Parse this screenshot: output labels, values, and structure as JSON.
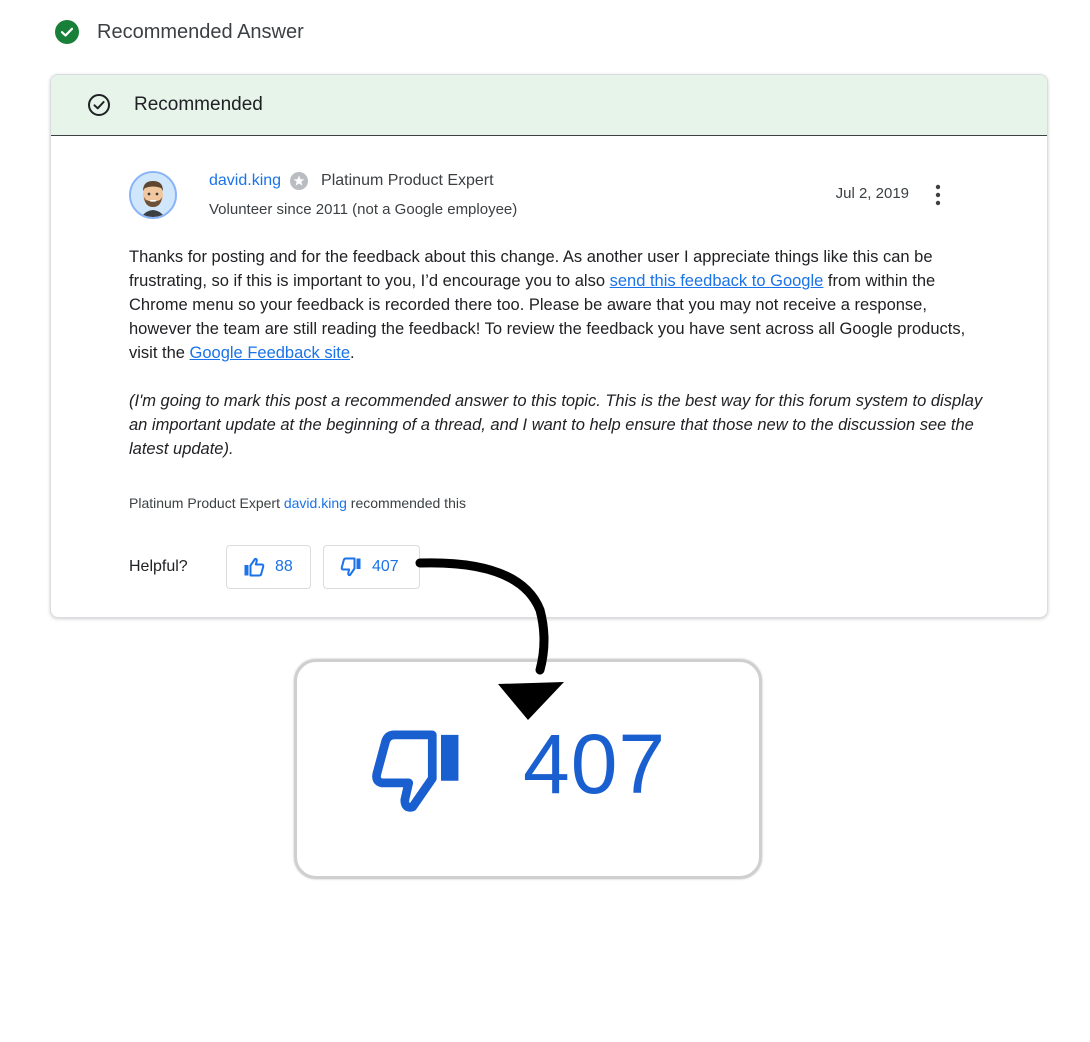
{
  "header": {
    "title": "Recommended Answer"
  },
  "card": {
    "banner_label": "Recommended",
    "author": {
      "name": "david.king",
      "title": "Platinum Product Expert",
      "volunteer": "Volunteer since 2011 (not a Google employee)",
      "date": "Jul 2, 2019"
    },
    "body": {
      "p1_part1": "Thanks for posting and for the feedback about this change. As another user I appreciate things like this can be frustrating, so if this is important to you, I’d encourage you to also ",
      "p1_link1": "send this feedback to Google",
      "p1_part2": " from within the Chrome menu so your feedback is recorded there too. Please be aware that you may not receive a response, however the team are still reading the feedback! To review the feedback you have sent across all Google products, visit the ",
      "p1_link2": "Google Feedback site",
      "p1_part3": ".",
      "note": "(I'm going to mark this post a recommended answer to this topic. This is the best way for this forum system to display an important update at the beginning of a thread, and I want to help ensure that those new to the discussion see the latest update)."
    },
    "recommended_by": {
      "prefix": "Platinum Product Expert ",
      "name": "david.king",
      "suffix": " recommended this"
    },
    "helpful": {
      "label": "Helpful?",
      "up_count": "88",
      "down_count": "407"
    }
  },
  "zoom": {
    "count": "407"
  },
  "colors": {
    "accent_blue": "#1a73e8",
    "success_green": "#188038",
    "banner_bg": "#e6f4ea"
  },
  "icons": [
    "check-circle-icon",
    "outline-check-icon",
    "product-expert-badge-icon",
    "more-vert-icon",
    "thumb-up-icon",
    "thumb-down-icon"
  ]
}
